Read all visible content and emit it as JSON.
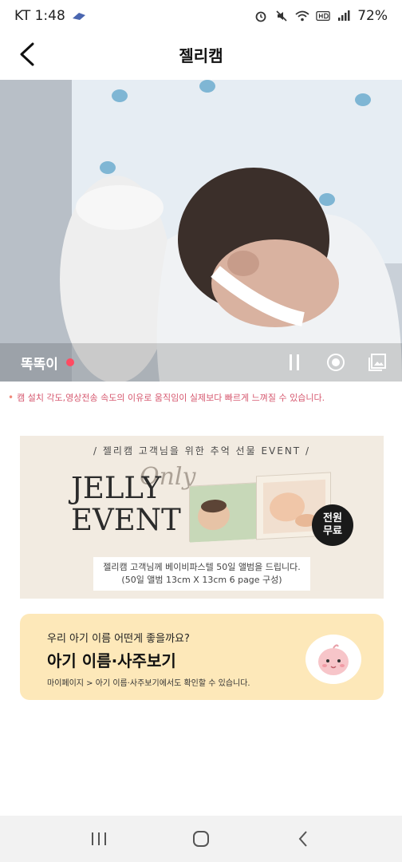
{
  "status_bar": {
    "carrier_time": "KT 1:48",
    "battery": "72%"
  },
  "app_bar": {
    "title": "젤리캠"
  },
  "video": {
    "label": "똑똑이"
  },
  "notice": "캠 설치 각도,영상전송 속도의 이유로 움직임이 실제보다 빠르게 느껴질 수 있습니다.",
  "banner": {
    "top_text": "/ 젤리캠 고객님을 위한 추억 선물 EVENT /",
    "line1": "JELLY",
    "line2": "EVENT",
    "script": "Only",
    "badge_line1": "전원",
    "badge_line2": "무료",
    "box_line1": "젤리캠 고객님께 베이비파스텔 50일 앨범을 드립니다.",
    "box_line2": "(50일 앨범 13cm X 13cm 6 page 구성)"
  },
  "name_card": {
    "question": "우리 아기 이름 어떤게 좋을까요?",
    "title": "아기 이름·사주보기",
    "subtitle": "마이페이지 > 아기 이름·사주보기에서도 확인할 수 있습니다."
  },
  "colors": {
    "accent": "#ff4b62",
    "card_bg": "#fde8b9",
    "banner_bg": "#f2ebe1"
  }
}
